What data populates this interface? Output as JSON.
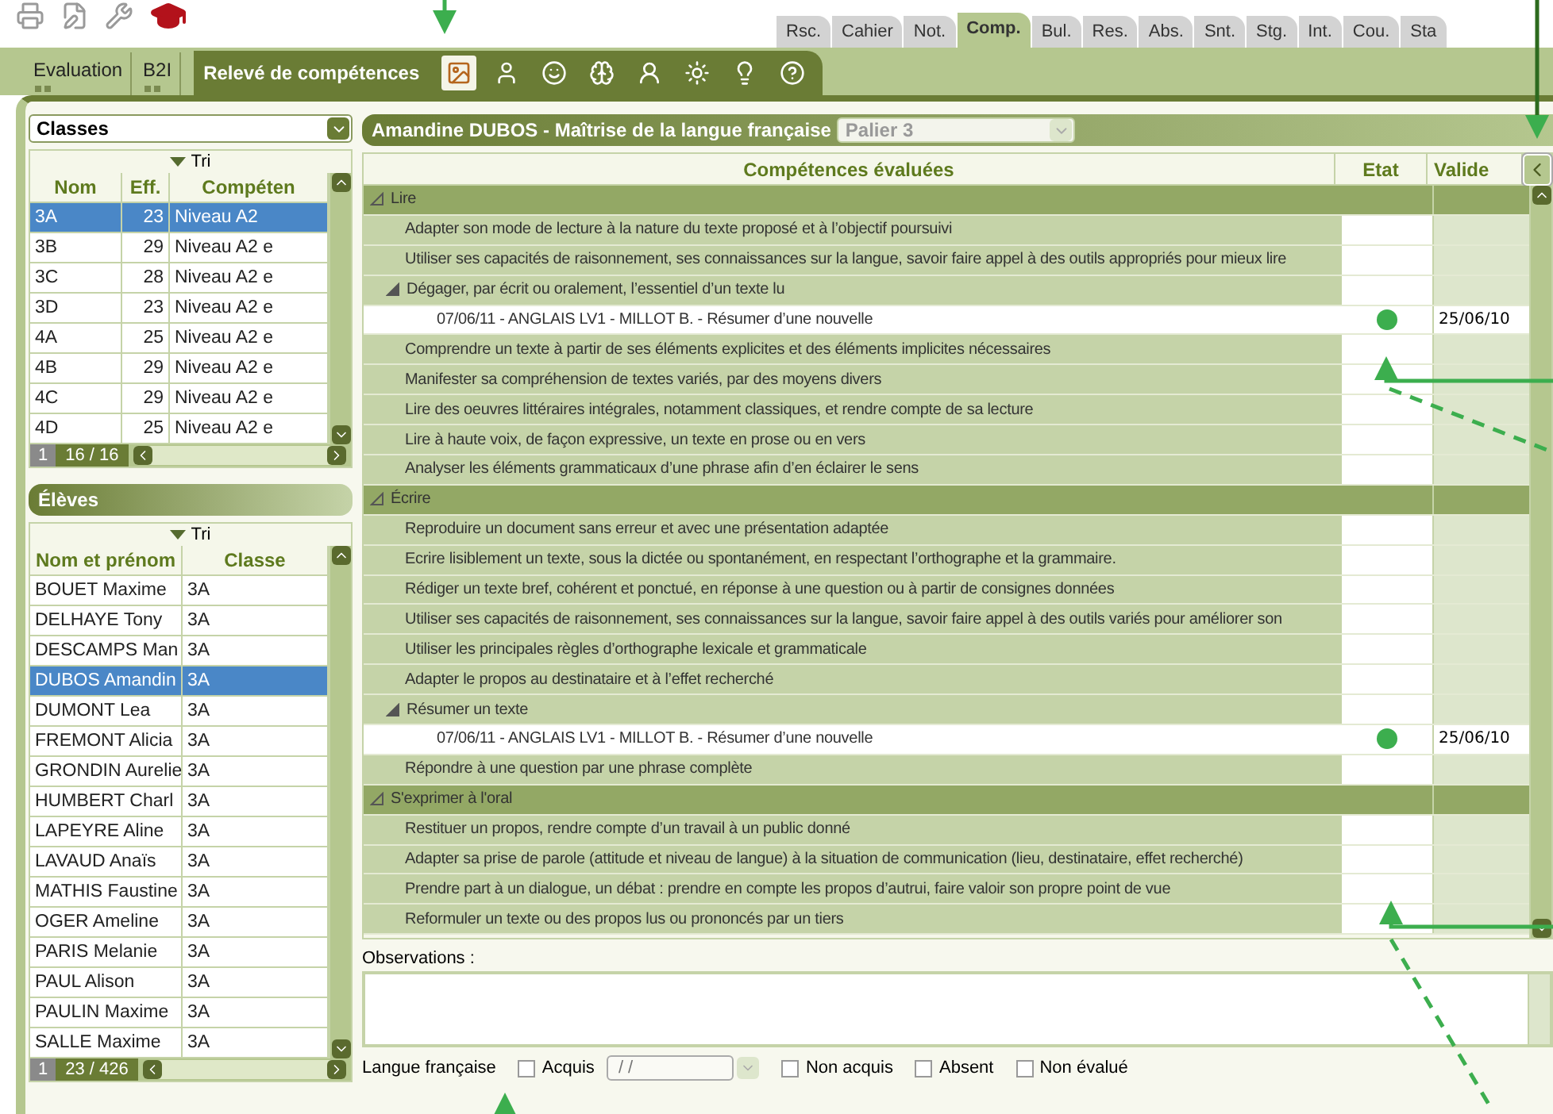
{
  "tabs": [
    {
      "label": "Rsc.",
      "selected": false
    },
    {
      "label": "Cahier",
      "selected": false
    },
    {
      "label": "Not.",
      "selected": false
    },
    {
      "label": "Comp.",
      "selected": true
    },
    {
      "label": "Bul.",
      "selected": false
    },
    {
      "label": "Res.",
      "selected": false
    },
    {
      "label": "Abs.",
      "selected": false
    },
    {
      "label": "Snt.",
      "selected": false
    },
    {
      "label": "Stg.",
      "selected": false
    },
    {
      "label": "Int.",
      "selected": false
    },
    {
      "label": "Cou.",
      "selected": false
    },
    {
      "label": "Sta",
      "selected": false
    }
  ],
  "subtabs": [
    {
      "label": "Evaluation",
      "selected": false
    },
    {
      "label": "B2I",
      "selected": false
    },
    {
      "label": "Relevé de compétences",
      "selected": true
    }
  ],
  "domain_icons": [
    {
      "selected": true
    },
    {
      "selected": false
    },
    {
      "selected": false
    },
    {
      "selected": false
    },
    {
      "selected": false
    },
    {
      "selected": false
    },
    {
      "selected": false
    },
    {
      "selected": false
    }
  ],
  "classes_dropdown": {
    "value": "Classes"
  },
  "classes_table": {
    "sort_label": "Tri",
    "columns": [
      "Nom",
      "Eff.",
      "Compéten"
    ],
    "rows": [
      {
        "cells": [
          "3A",
          "23",
          "Niveau A2"
        ],
        "selected": true
      },
      {
        "cells": [
          "3B",
          "29",
          "Niveau A2 e"
        ],
        "selected": false
      },
      {
        "cells": [
          "3C",
          "28",
          "Niveau A2 e"
        ],
        "selected": false
      },
      {
        "cells": [
          "3D",
          "23",
          "Niveau A2 e"
        ],
        "selected": false
      },
      {
        "cells": [
          "4A",
          "25",
          "Niveau A2 e"
        ],
        "selected": false
      },
      {
        "cells": [
          "4B",
          "29",
          "Niveau A2 e"
        ],
        "selected": false
      },
      {
        "cells": [
          "4C",
          "29",
          "Niveau A2 e"
        ],
        "selected": false
      },
      {
        "cells": [
          "4D",
          "25",
          "Niveau A2 e"
        ],
        "selected": false
      }
    ],
    "page": "1",
    "count": "16 / 16"
  },
  "students_title": "Élèves",
  "students_table": {
    "sort_label": "Tri",
    "columns": [
      "Nom et prénom",
      "Classe"
    ],
    "rows": [
      {
        "cells": [
          "BOUET Maxime",
          "3A"
        ],
        "selected": false
      },
      {
        "cells": [
          "DELHAYE Tony",
          "3A"
        ],
        "selected": false
      },
      {
        "cells": [
          "DESCAMPS Man",
          "3A"
        ],
        "selected": false
      },
      {
        "cells": [
          "DUBOS Amandin",
          "3A"
        ],
        "selected": true
      },
      {
        "cells": [
          "DUMONT Lea",
          "3A"
        ],
        "selected": false
      },
      {
        "cells": [
          "FREMONT Alicia",
          "3A"
        ],
        "selected": false
      },
      {
        "cells": [
          "GRONDIN Aurelie",
          "3A"
        ],
        "selected": false
      },
      {
        "cells": [
          "HUMBERT Charl",
          "3A"
        ],
        "selected": false
      },
      {
        "cells": [
          "LAPEYRE Aline",
          "3A"
        ],
        "selected": false
      },
      {
        "cells": [
          "LAVAUD Anaïs",
          "3A"
        ],
        "selected": false
      },
      {
        "cells": [
          "MATHIS Faustine",
          "3A"
        ],
        "selected": false
      },
      {
        "cells": [
          "OGER Ameline",
          "3A"
        ],
        "selected": false
      },
      {
        "cells": [
          "PARIS Melanie",
          "3A"
        ],
        "selected": false
      },
      {
        "cells": [
          "PAUL Alison",
          "3A"
        ],
        "selected": false
      },
      {
        "cells": [
          "PAULIN Maxime",
          "3A"
        ],
        "selected": false
      },
      {
        "cells": [
          "SALLE Maxime",
          "3A"
        ],
        "selected": false
      }
    ],
    "page": "1",
    "count": "23 / 426"
  },
  "report": {
    "title": "Amandine DUBOS - Maîtrise de la langue française",
    "level_select": {
      "value": "Palier 3"
    },
    "columns": [
      "Compétences évaluées",
      "Etat",
      "Valide"
    ],
    "rows": [
      {
        "label": "Lire",
        "expanded": true,
        "children": [
          {
            "label": "Adapter son mode de lecture à la nature du texte proposé et à l’objectif poursuivi"
          },
          {
            "label": "Utiliser ses capacités de raisonnement, ses connaissances sur la langue, savoir faire appel à des outils appropriés pour mieux lire"
          },
          {
            "label": "Dégager, par écrit ou oralement, l’essentiel d’un texte lu",
            "expanded": true,
            "children": [
              {
                "label": "07/06/11 - ANGLAIS LV1 - MILLOT B. - Résumer d’une nouvelle",
                "acquired": true,
                "validated": "25/06/10"
              }
            ]
          },
          {
            "label": "Comprendre un texte à partir de ses éléments explicites et des éléments implicites nécessaires"
          },
          {
            "label": "Manifester sa compréhension de textes variés, par des moyens divers"
          },
          {
            "label": "Lire des oeuvres littéraires intégrales, notamment classiques, et rendre compte de sa lecture"
          },
          {
            "label": "Lire à haute voix, de façon expressive, un texte en prose ou en vers"
          },
          {
            "label": "Analyser les éléments grammaticaux d’une phrase afin d’en éclairer le sens"
          }
        ]
      },
      {
        "label": "Écrire",
        "expanded": true,
        "children": [
          {
            "label": "Reproduire un document sans erreur et avec une présentation adaptée"
          },
          {
            "label": "Ecrire lisiblement un texte, sous la dictée ou spontanément, en respectant l’orthographe et la grammaire."
          },
          {
            "label": "Rédiger un texte bref, cohérent et ponctué, en réponse à une question ou à partir de consignes données"
          },
          {
            "label": "Utiliser ses capacités de raisonnement, ses connaissances sur la langue, savoir faire appel à des outils variés pour améliorer son"
          },
          {
            "label": "Utiliser les principales règles d’orthographe lexicale et grammaticale"
          },
          {
            "label": "Adapter le propos au destinataire et à l’effet recherché"
          },
          {
            "label": "Résumer un texte",
            "expanded": true,
            "children": [
              {
                "label": "07/06/11 - ANGLAIS LV1 - MILLOT B. - Résumer d’une nouvelle",
                "acquired": true,
                "validated": "25/06/10"
              }
            ]
          },
          {
            "label": "Répondre à une question par une phrase complète"
          }
        ]
      },
      {
        "label": "S'exprimer à l'oral",
        "expanded": true,
        "children": [
          {
            "label": "Restituer un propos, rendre compte d’un travail à un public donné"
          },
          {
            "label": "Adapter sa prise de parole (attitude et niveau de langue) à la situation de communication (lieu, destinataire, effet recherché)"
          },
          {
            "label": "Prendre part à un dialogue, un débat : prendre en compte les propos d’autrui, faire valoir son propre point de vue"
          },
          {
            "label": "Reformuler un texte ou des propos lus ou prononcés par un tiers"
          }
        ]
      }
    ]
  },
  "observations_label": "Observations :",
  "bottom": {
    "domain": "Langue française",
    "date_field": {
      "placeholder": "/ /"
    },
    "options": [
      {
        "kind": "date",
        "label": "Acquis",
        "checked": false
      },
      {
        "kind": "plain",
        "label": "Non acquis",
        "checked": false
      },
      {
        "kind": "plain",
        "label": "Absent",
        "checked": false
      },
      {
        "kind": "plain",
        "label": "Non évalué",
        "checked": false
      }
    ]
  }
}
